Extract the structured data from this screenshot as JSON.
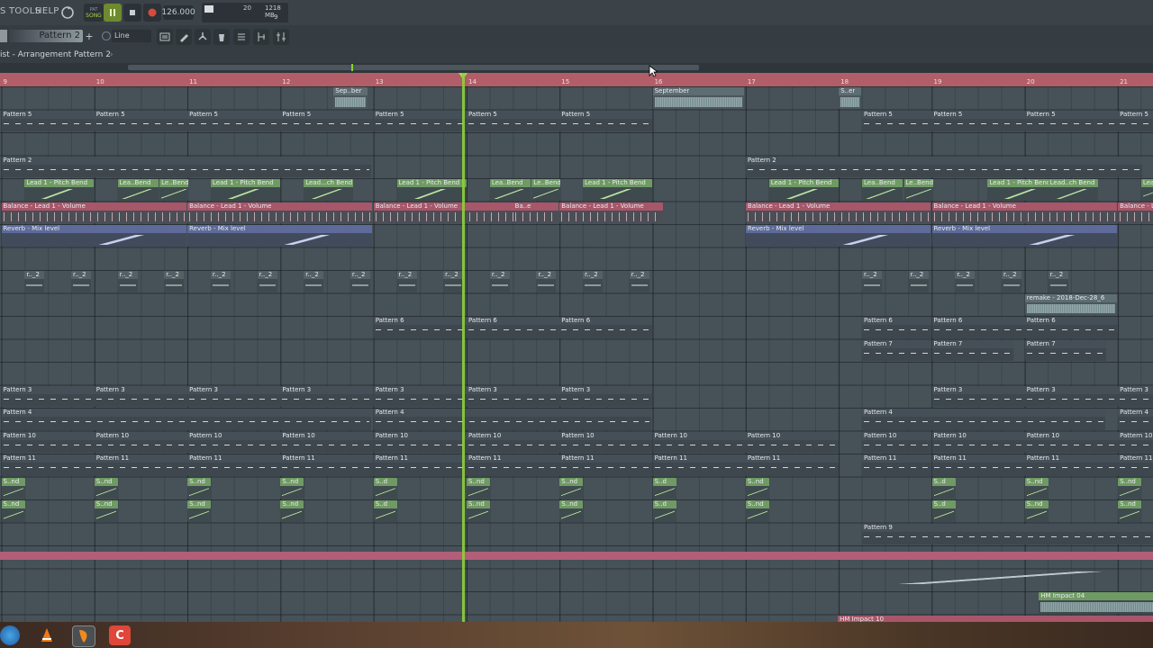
{
  "menu": {
    "items": [
      "S",
      "TOOLS",
      "HELP"
    ]
  },
  "transport": {
    "mode_pat": "PAT",
    "mode_song": "SONG",
    "tempo": "126.000"
  },
  "monitor": {
    "cpu": "20",
    "memory": "1218 MB",
    "polyphony": "9"
  },
  "toolbar": {
    "pattern_selector": "Pattern 2",
    "snap": "Line"
  },
  "breadcrumb": {
    "first": "ist - Arrangement",
    "second": "Pattern 2"
  },
  "ruler": {
    "bars": [
      "9",
      "10",
      "11",
      "12",
      "13",
      "14",
      "15",
      "16",
      "17",
      "18",
      "19",
      "20",
      "21"
    ]
  },
  "clips": [
    [
      "Sep..ber"
    ],
    [
      "September"
    ],
    [
      "S..er"
    ],
    [
      "Pattern 5"
    ],
    [
      "Pattern 5"
    ],
    [
      "Pattern 5"
    ],
    [
      "Pattern 5"
    ],
    [
      "Pattern 5"
    ],
    [
      "Pattern 5"
    ],
    [
      "Pattern 5"
    ],
    [
      "Pattern 5"
    ],
    [
      "Pattern 5"
    ],
    [
      "Pattern 5"
    ],
    [
      "Pattern 5"
    ],
    [
      "Pattern 2"
    ],
    [
      "Pattern 2"
    ],
    [
      "Lead 1 - Pitch Bend"
    ],
    [
      "Lea..Bend"
    ],
    [
      "Le..Bend"
    ],
    [
      "Lead 1 - Pitch Bend"
    ],
    [
      "Lead...ch Bend"
    ],
    [
      "Lead 1 - Pitch Bend"
    ],
    [
      "Lea..Bend"
    ],
    [
      "Le..Bend"
    ],
    [
      "Lead 1 - Pitch Bend"
    ],
    [
      "Lead 1 - Pitch Bend"
    ],
    [
      "Lea..Bend"
    ],
    [
      "Le..Bend"
    ],
    [
      "Lead 1 - Pitch Bend"
    ],
    [
      "Lead..ch Bend"
    ],
    [
      "Lea"
    ],
    [
      "Balance - Lead 1 - Volume"
    ],
    [
      "Balance - Lead 1 - Volume"
    ],
    [
      "Balance - Lead 1 - Volume"
    ],
    [
      "Ba..e"
    ],
    [
      "Balance - Lead 1 - Volume"
    ],
    [
      "Balance - Lead 1 - Volume"
    ],
    [
      "Balance - Lead 1 - Volume"
    ],
    [
      "Balance - L"
    ],
    [
      "Reverb - Mix level"
    ],
    [
      "Reverb - Mix level"
    ],
    [
      "Reverb - Mix level"
    ],
    [
      "Reverb - Mix level"
    ],
    [
      "r.._2"
    ],
    [
      "r.._2"
    ],
    [
      "r.._2"
    ],
    [
      "r.._2"
    ],
    [
      "r.._2"
    ],
    [
      "r.._2"
    ],
    [
      "r.._2"
    ],
    [
      "r.._2"
    ],
    [
      "r.._2"
    ],
    [
      "r.._2"
    ],
    [
      "r.._2"
    ],
    [
      "r.._2"
    ],
    [
      "r.._2"
    ],
    [
      "r.._2"
    ],
    [
      "r.._2"
    ],
    [
      "r.._2"
    ],
    [
      "r.._2"
    ],
    [
      "r.._2"
    ],
    [
      "r.._2"
    ],
    [
      "remake - 2018-Dec-28_6"
    ],
    [
      "Pattern 6"
    ],
    [
      "Pattern 6"
    ],
    [
      "Pattern 6"
    ],
    [
      "Pattern 6"
    ],
    [
      "Pattern 6"
    ],
    [
      "Pattern 6"
    ],
    [
      "Pattern 7"
    ],
    [
      "Pattern 7"
    ],
    [
      "Pattern 7"
    ],
    [
      "Pattern 3"
    ],
    [
      "Pattern 3"
    ],
    [
      "Pattern 3"
    ],
    [
      "Pattern 3"
    ],
    [
      "Pattern 3"
    ],
    [
      "Pattern 3"
    ],
    [
      "Pattern 3"
    ],
    [
      "Pattern 3"
    ],
    [
      "Pattern 3"
    ],
    [
      "Pattern 3"
    ],
    [
      "Pattern 4"
    ],
    [
      "Pattern 4"
    ],
    [
      "Pattern 4"
    ],
    [
      "Pattern 4"
    ],
    [
      "Pattern 10"
    ],
    [
      "Pattern 10"
    ],
    [
      "Pattern 10"
    ],
    [
      "Pattern 10"
    ],
    [
      "Pattern 10"
    ],
    [
      "Pattern 10"
    ],
    [
      "Pattern 10"
    ],
    [
      "Pattern 10"
    ],
    [
      "Pattern 10"
    ],
    [
      "Pattern 10"
    ],
    [
      "Pattern 10"
    ],
    [
      "Pattern 10"
    ],
    [
      "Pattern 10"
    ],
    [
      "Pattern 11"
    ],
    [
      "Pattern 11"
    ],
    [
      "Pattern 11"
    ],
    [
      "Pattern 11"
    ],
    [
      "Pattern 11"
    ],
    [
      "Pattern 11"
    ],
    [
      "Pattern 11"
    ],
    [
      "Pattern 11"
    ],
    [
      "Pattern 11"
    ],
    [
      "Pattern 11"
    ],
    [
      "Pattern 11"
    ],
    [
      "Pattern 11"
    ],
    [
      "Pattern 11"
    ],
    [
      "S..nd"
    ],
    [
      "S..nd"
    ],
    [
      "S..nd"
    ],
    [
      "S..nd"
    ],
    [
      "S..d"
    ],
    [
      "S..nd"
    ],
    [
      "S..nd"
    ],
    [
      "S..d"
    ],
    [
      "S..nd"
    ],
    [
      "S..d"
    ],
    [
      "S..nd"
    ],
    [
      "S..nd"
    ],
    [
      "S..nd"
    ],
    [
      "S..nd"
    ],
    [
      "S..nd"
    ],
    [
      "S..nd"
    ],
    [
      "S..d"
    ],
    [
      "S..nd"
    ],
    [
      "S..nd"
    ],
    [
      "S..d"
    ],
    [
      "S..nd"
    ],
    [
      "S..d"
    ],
    [
      "S..nd"
    ],
    [
      "S..nd"
    ],
    [
      "Pattern 9"
    ],
    [
      "HM Impact 04"
    ],
    [
      "HM Impact 10"
    ]
  ],
  "colors": {
    "audio": "#7e9a9c",
    "pattern": "#3e474e",
    "automation": "#6f9a63",
    "balance": "#a8566a",
    "reverb": "#5d6a9a",
    "pink_lane": "#b25e78",
    "playhead": "#8cd03a"
  },
  "taskbar": {
    "icons": [
      "windows-orb-icon",
      "vlc-icon",
      "fl-studio-icon",
      "camtasia-icon"
    ]
  }
}
